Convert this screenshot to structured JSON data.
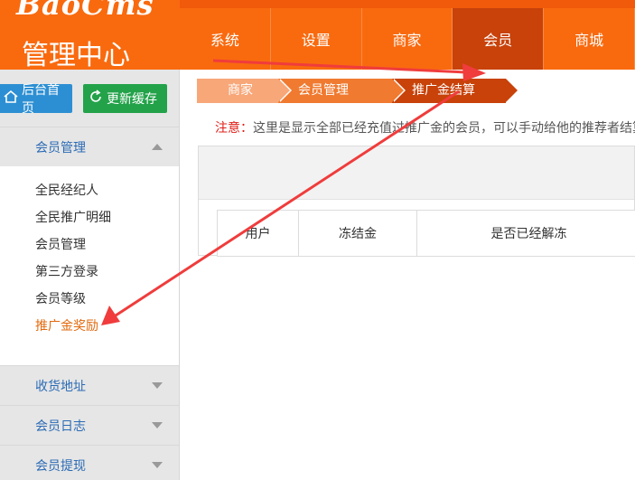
{
  "header": {
    "logo_text": "BaoCms",
    "subtitle": "管理中心",
    "nav": [
      {
        "label": "系统",
        "active": false
      },
      {
        "label": "设置",
        "active": false
      },
      {
        "label": "商家",
        "active": false
      },
      {
        "label": "会员",
        "active": true
      },
      {
        "label": "商城",
        "active": false
      }
    ]
  },
  "sidebar": {
    "home_button": "后台首页",
    "refresh_button": "更新缓存",
    "sections": [
      {
        "label": "会员管理",
        "expanded": true
      },
      {
        "label": "收货地址",
        "expanded": false
      },
      {
        "label": "会员日志",
        "expanded": false
      },
      {
        "label": "会员提现",
        "expanded": false
      }
    ],
    "items": [
      "全民经纪人",
      "全民推广明细",
      "会员管理",
      "第三方登录",
      "会员等级",
      "推广金奖励"
    ],
    "active_item": "推广金奖励"
  },
  "main": {
    "breadcrumb": [
      "商家",
      "会员管理",
      "推广金结算"
    ],
    "notice_label": "注意：",
    "notice_text": "这里是显示全部已经充值过推广金的会员，可以手动给他的推荐者结算",
    "table_headers": [
      "用户",
      "冻结金",
      "是否已经解冻"
    ]
  },
  "colors": {
    "brand_orange": "#f96a0e",
    "nav_active": "#c8420a",
    "link_blue": "#2b6bb5",
    "active_orange": "#e26a0f",
    "warning_red": "#e0201a",
    "arrow_red": "#f03c3c"
  },
  "icons": [
    "home-icon",
    "refresh-icon",
    "caret-up-icon",
    "caret-down-icon"
  ]
}
